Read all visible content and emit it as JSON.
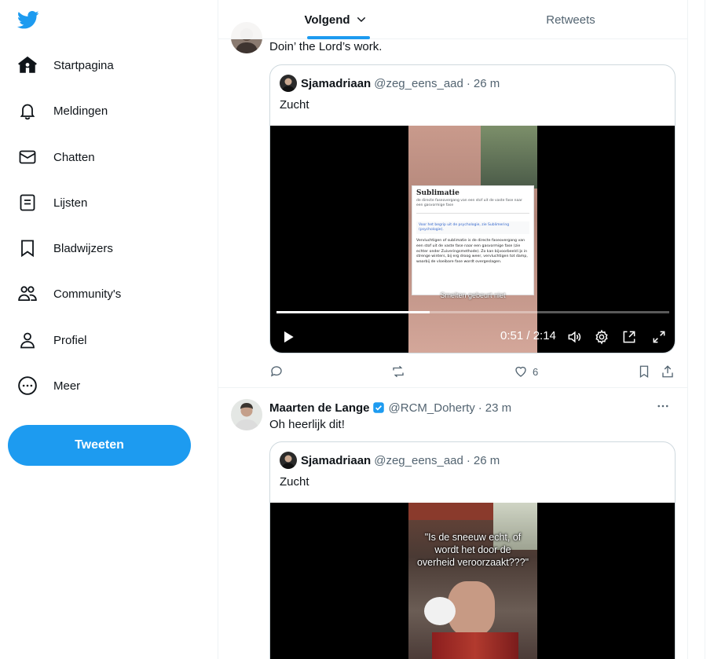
{
  "nav": {
    "items": [
      {
        "label": "Startpagina",
        "icon": "home-icon"
      },
      {
        "label": "Meldingen",
        "icon": "bell-icon"
      },
      {
        "label": "Chatten",
        "icon": "envelope-icon"
      },
      {
        "label": "Lijsten",
        "icon": "list-icon"
      },
      {
        "label": "Bladwijzers",
        "icon": "bookmark-icon"
      },
      {
        "label": "Community's",
        "icon": "communities-icon"
      },
      {
        "label": "Profiel",
        "icon": "person-icon"
      },
      {
        "label": "Meer",
        "icon": "more-circle-icon"
      }
    ],
    "tweet_button": "Tweeten"
  },
  "tabs": {
    "following": "Volgend",
    "retweets": "Retweets"
  },
  "tweets": [
    {
      "text": "Doin’ the Lord’s work.",
      "quote": {
        "name": "Sjamadriaan",
        "handle": "@zeg_eens_aad",
        "sep": "·",
        "time": "26 m",
        "text": "Zucht",
        "video": {
          "time_display": "0:51 / 2:14",
          "progress": 0.39,
          "screen": {
            "title": "Sublimatie",
            "subtitle": "de directe faseovergang van een stof uit de vaste fase naar een gasvormige fase",
            "note": "Voor het begrip uit de psychologie, zie Sublimering (psychologie).",
            "body": "Vervluchtigen of sublimatie is de directe faseovergang van een stof uit de vaste fase naar een gasvormige fase (zie echter onder Zuiveringsmethode). Zo kan bijvoorbeeld ijs in strenge winters, bij erg droog weer, vervluchtigen tot damp, waarbij de vloeibare fase wordt overgeslagen.",
            "caption": "Smelten gebeurt niet"
          }
        }
      },
      "likes": "6"
    },
    {
      "name": "Maarten de Lange",
      "handle": "@RCM_Doherty",
      "sep": "·",
      "time": "23 m",
      "text": "Oh heerlijk dit!",
      "quote": {
        "name": "Sjamadriaan",
        "handle": "@zeg_eens_aad",
        "sep": "·",
        "time": "26 m",
        "text": "Zucht",
        "video": {
          "caption": "\"Is de sneeuw echt, of wordt het door de overheid veroorzaakt???\""
        }
      }
    }
  ],
  "colors": {
    "accent": "#1d9bf0",
    "text": "#0f1419",
    "muted": "#536471",
    "border": "#eff3f4"
  }
}
